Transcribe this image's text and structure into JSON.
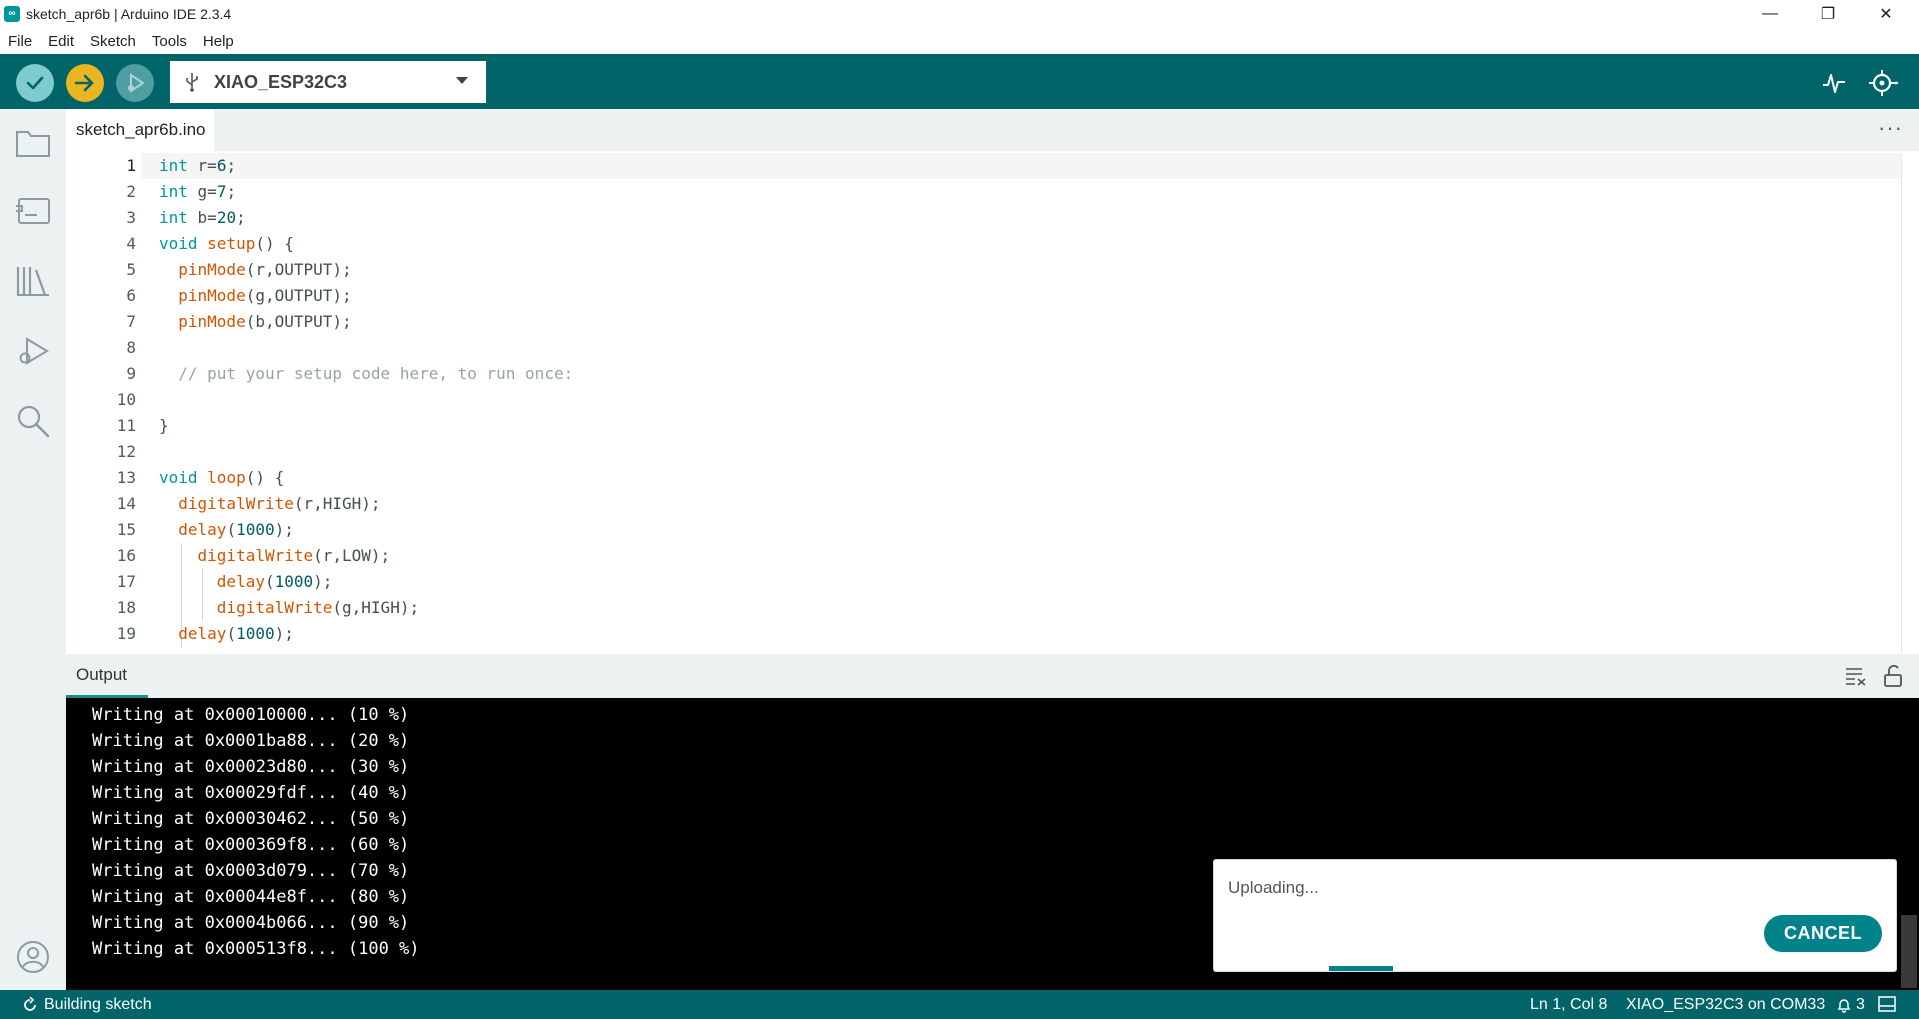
{
  "window": {
    "title": "sketch_apr6b | Arduino IDE 2.3.4",
    "minimize": "—",
    "maximize": "❐",
    "close": "✕"
  },
  "menu": [
    "File",
    "Edit",
    "Sketch",
    "Tools",
    "Help"
  ],
  "toolbar": {
    "board": "XIAO_ESP32C3"
  },
  "editor": {
    "tab": "sketch_apr6b.ino",
    "tabs_more": "···",
    "lines": [
      {
        "n": "1",
        "text": "int r=6;"
      },
      {
        "n": "2",
        "text": "int g=7;"
      },
      {
        "n": "3",
        "text": "int b=20;"
      },
      {
        "n": "4",
        "text": "void setup() {"
      },
      {
        "n": "5",
        "text": "  pinMode(r,OUTPUT);"
      },
      {
        "n": "6",
        "text": "  pinMode(g,OUTPUT);"
      },
      {
        "n": "7",
        "text": "  pinMode(b,OUTPUT);"
      },
      {
        "n": "8",
        "text": ""
      },
      {
        "n": "9",
        "text": "  // put your setup code here, to run once:"
      },
      {
        "n": "10",
        "text": ""
      },
      {
        "n": "11",
        "text": "}"
      },
      {
        "n": "12",
        "text": ""
      },
      {
        "n": "13",
        "text": "void loop() {"
      },
      {
        "n": "14",
        "text": "  digitalWrite(r,HIGH);"
      },
      {
        "n": "15",
        "text": "  delay(1000);"
      },
      {
        "n": "16",
        "text": "    digitalWrite(r,LOW);"
      },
      {
        "n": "17",
        "text": "      delay(1000);"
      },
      {
        "n": "18",
        "text": "      digitalWrite(g,HIGH);"
      },
      {
        "n": "19",
        "text": "  delay(1000);"
      }
    ]
  },
  "output": {
    "tab": "Output",
    "lines": [
      "Writing at 0x00010000... (10 %)",
      "Writing at 0x0001ba88... (20 %)",
      "Writing at 0x00023d80... (30 %)",
      "Writing at 0x00029fdf... (40 %)",
      "Writing at 0x00030462... (50 %)",
      "Writing at 0x000369f8... (60 %)",
      "Writing at 0x0003d079... (70 %)",
      "Writing at 0x00044e8f... (80 %)",
      "Writing at 0x0004b066... (90 %)",
      "Writing at 0x000513f8... (100 %)"
    ]
  },
  "notification": {
    "message": "Uploading...",
    "cancel": "CANCEL"
  },
  "status": {
    "task": "Building sketch",
    "cursor": "Ln 1, Col 8",
    "board_port": "XIAO_ESP32C3 on COM33",
    "notifications": "3"
  },
  "colors": {
    "toolbar": "#006468",
    "verify": "#7fcbcd",
    "upload": "#e8b620",
    "accent": "#00838a"
  }
}
